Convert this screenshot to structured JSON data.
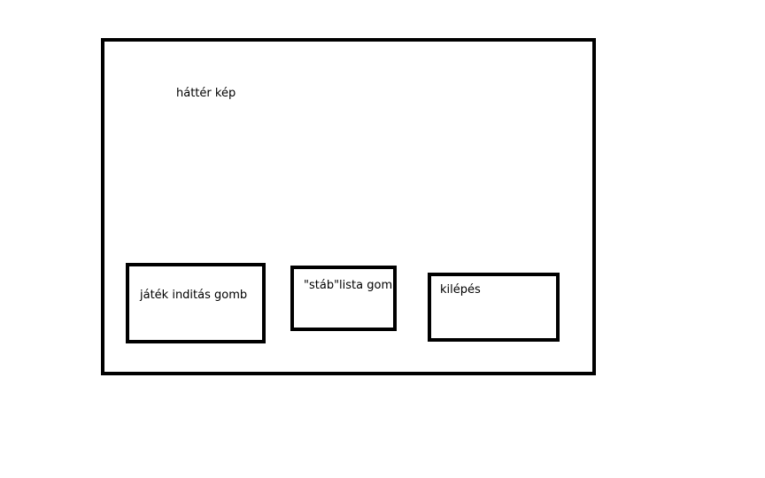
{
  "screen": {
    "background_label": "háttér kép"
  },
  "buttons": {
    "start_label": "játék inditás gomb",
    "credits_label": "\"stáb\"lista gomb",
    "exit_label": "kilépés"
  },
  "colors": {
    "stroke": "#000000",
    "background": "#ffffff"
  }
}
